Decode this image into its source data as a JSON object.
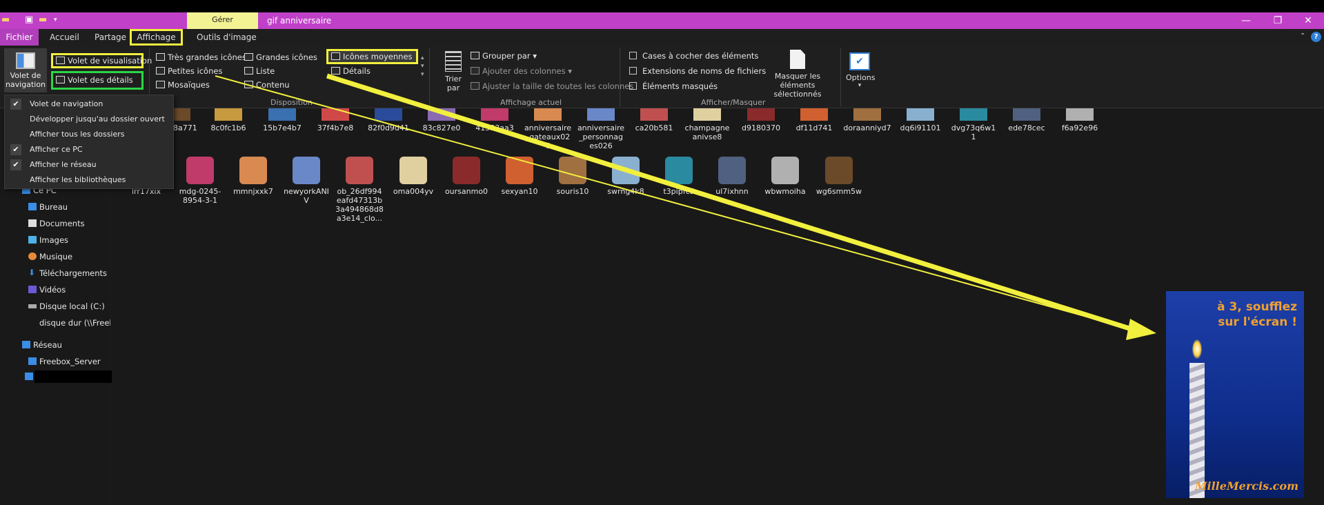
{
  "window": {
    "title": "gif anniversaire",
    "context_tab": "Gérer",
    "minimize": "—",
    "maximize": "❐",
    "close": "✕"
  },
  "menu": {
    "fichier": "Fichier",
    "tabs": [
      "Accueil",
      "Partage",
      "Affichage",
      "Outils d'image"
    ],
    "help": "?"
  },
  "ribbon": {
    "volets": {
      "nav_label": "Volet de navigation",
      "preview": "Volet de visualisation",
      "details": "Volet des détails"
    },
    "disposition": {
      "items": [
        "Très grandes icônes",
        "Grandes icônes",
        "Icônes moyennes",
        "Petites icônes",
        "Liste",
        "Détails",
        "Mosaïques",
        "Contenu"
      ],
      "group": "Disposition"
    },
    "affichage": {
      "sort": "Trier par",
      "groupby": "Grouper par",
      "addcols": "Ajouter des colonnes",
      "fitcols": "Ajuster la taille de toutes les colonnes",
      "group": "Affichage actuel"
    },
    "afficher": {
      "checkboxes": "Cases à cocher des éléments",
      "extensions": "Extensions de noms de fichiers",
      "hidden": "Éléments masqués",
      "hide_selected": "Masquer les éléments sélectionnés",
      "group": "Afficher/Masquer"
    },
    "options": "Options"
  },
  "dropdown": {
    "items": [
      {
        "label": "Volet de navigation",
        "checked": true
      },
      {
        "label": "Développer jusqu'au dossier ouvert",
        "checked": false
      },
      {
        "label": "Afficher tous les dossiers",
        "checked": false
      },
      {
        "label": "Afficher ce PC",
        "checked": true
      },
      {
        "label": "Afficher le réseau",
        "checked": true
      },
      {
        "label": "Afficher les bibliothèques",
        "checked": false
      }
    ]
  },
  "nav": {
    "items": [
      "Ce PC",
      "Bureau",
      "Documents",
      "Images",
      "Musique",
      "Téléchargements",
      "Vidéos",
      "Disque local (C:)",
      "disque dur (\\\\Freeb",
      "Réseau",
      "Freebox_Server"
    ]
  },
  "files": {
    "row1": [
      "06f78a771",
      "8c0fc1b6",
      "15b7e4b7",
      "37f4b7e8",
      "82f0d9d41",
      "83c827e0",
      "41533aa3",
      "anniversaire_gateaux026",
      "anniversaire_personnages026",
      "ca20b581",
      "champagneanivse8",
      "d9180370",
      "df11d741",
      "doraanniyd7",
      "dq6i91101",
      "dvg73q6w11",
      "ede78cec",
      "f6a92e96"
    ],
    "row2": [
      "lrr17xix",
      "mdg-0245-8954-3-1",
      "mmnjxxk7",
      "newyorkANIV",
      "ob_26df994eafd47313b3a494868d8a3e14_clo...",
      "oma004yv",
      "oursanmo0",
      "sexyan10",
      "souris10",
      "swrng4k8",
      "t3pipfc5",
      "ul7ixhnn",
      "wbwmoiha",
      "wg6smm5w"
    ]
  },
  "promo": {
    "line1": "à 3, soufflez",
    "line2": "sur l'écran !",
    "brand": "MilleMercis.com"
  }
}
